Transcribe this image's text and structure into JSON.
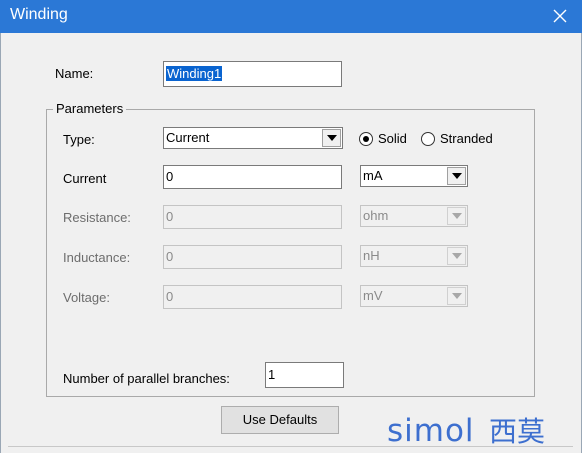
{
  "window": {
    "title": "Winding"
  },
  "name_field": {
    "label": "Name:",
    "value": "Winding1"
  },
  "parameters": {
    "group_title": "Parameters",
    "type": {
      "label": "Type:",
      "value": "Current",
      "options": [
        "Current"
      ]
    },
    "conductor": {
      "solid_label": "Solid",
      "stranded_label": "Stranded",
      "selected": "Solid"
    },
    "current": {
      "label": "Current",
      "value": "0",
      "unit": "mA"
    },
    "resistance": {
      "label": "Resistance:",
      "value": "0",
      "unit": "ohm"
    },
    "inductance": {
      "label": "Inductance:",
      "value": "0",
      "unit": "nH"
    },
    "voltage": {
      "label": "Voltage:",
      "value": "0",
      "unit": "mV"
    },
    "branches": {
      "label": "Number of parallel branches:",
      "value": "1"
    }
  },
  "buttons": {
    "use_defaults": "Use Defaults"
  },
  "watermark": {
    "text": "simol",
    "cn": "西莫",
    "color": "#3d6fcf"
  },
  "colors": {
    "titlebar": "#2b78d6",
    "selection": "#0a64d0"
  },
  "icons": {
    "close": "close-icon",
    "dropdown": "chevron-down-icon"
  }
}
